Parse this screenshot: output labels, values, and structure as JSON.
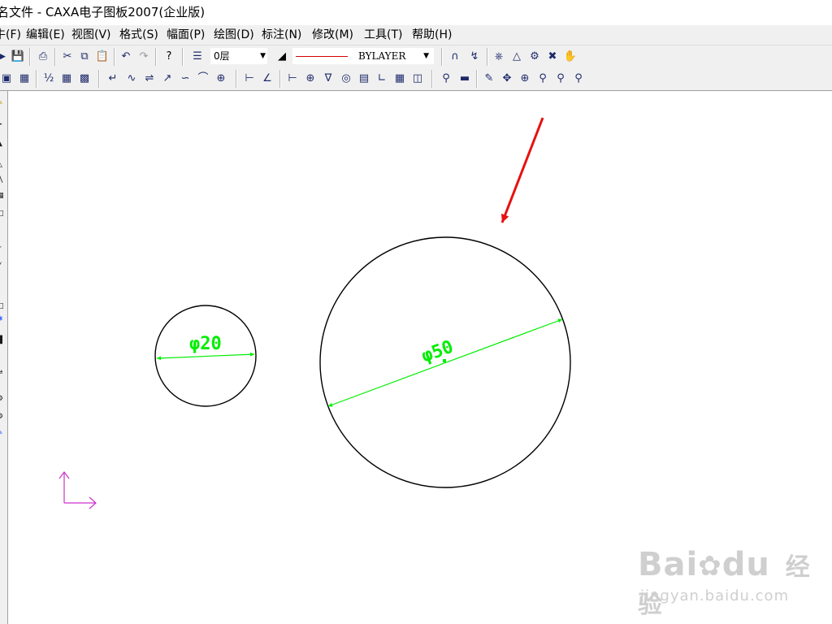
{
  "window": {
    "title": "名文件 - CAXA电子图板2007(企业版)"
  },
  "menu": [
    {
      "label": "牛(F)",
      "name": "menu-file"
    },
    {
      "label": "编辑(E)",
      "name": "menu-edit"
    },
    {
      "label": "视图(V)",
      "name": "menu-view"
    },
    {
      "label": "格式(S)",
      "name": "menu-format"
    },
    {
      "label": "幅面(P)",
      "name": "menu-sheet"
    },
    {
      "label": "绘图(D)",
      "name": "menu-draw"
    },
    {
      "label": "标注(N)",
      "name": "menu-dimension"
    },
    {
      "label": "修改(M)",
      "name": "menu-modify"
    },
    {
      "label": "工具(T)",
      "name": "menu-tools"
    },
    {
      "label": "帮助(H)",
      "name": "menu-help"
    }
  ],
  "toolbar": {
    "layer_value": "0层",
    "linetype_value": "BYLAYER"
  },
  "drawing": {
    "small_circle_dim": "φ20",
    "large_circle_dim": "φ50"
  },
  "colors": {
    "dimension": "#00ee00",
    "circle": "#000000",
    "arrow_annotation": "#e81010",
    "ucs": "#cc33cc",
    "linetype_sample": "#d40000"
  },
  "watermark": {
    "brand": "Bai",
    "brand2": "du",
    "cn": "经验",
    "url": "jingyan.baidu.com"
  }
}
